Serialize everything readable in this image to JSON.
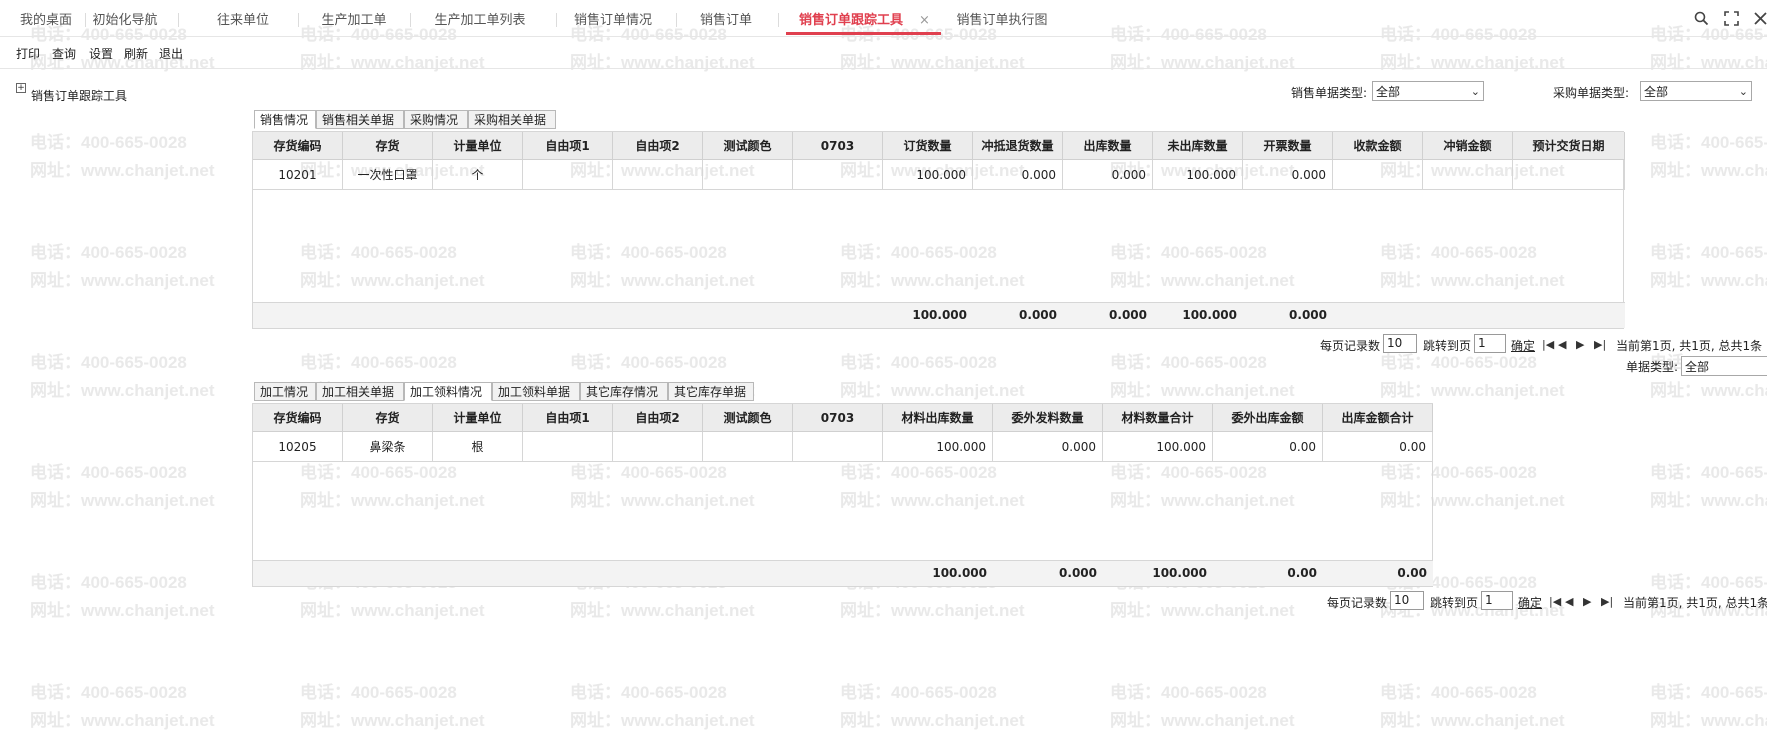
{
  "watermark": {
    "phone": "电话：400-665-0028",
    "site": "网址：www.chanjet.net"
  },
  "tabs": [
    {
      "label": "我的桌面"
    },
    {
      "label": "初始化导航"
    },
    {
      "label": "往来单位"
    },
    {
      "label": "生产加工单"
    },
    {
      "label": "生产加工单列表"
    },
    {
      "label": "销售订单情况"
    },
    {
      "label": "销售订单"
    },
    {
      "label": "销售订单跟踪工具",
      "active": true,
      "close": "×"
    },
    {
      "label": "销售订单执行图"
    }
  ],
  "top_icons": [
    "search-icon",
    "maximize-icon",
    "close-icon"
  ],
  "toolbar": {
    "print": "打印",
    "query": "查询",
    "settings": "设置",
    "refresh": "刷新",
    "exit": "退出"
  },
  "tree": {
    "expander": "+",
    "root_label": "销售订单跟踪工具"
  },
  "filters": {
    "sales_type_label": "销售单据类型:",
    "sales_type_value": "全部",
    "purchase_type_label": "采购单据类型:",
    "purchase_type_value": "全部",
    "doc_type_label": "单据类型:",
    "doc_type_value": "全部"
  },
  "upper": {
    "tabs": [
      "销售情况",
      "销售相关单据",
      "采购情况",
      "采购相关单据"
    ],
    "columns": [
      "存货编码",
      "存货",
      "计量单位",
      "自由项1",
      "自由项2",
      "测试颜色",
      "0703",
      "订货数量",
      "冲抵退货数量",
      "出库数量",
      "未出库数量",
      "开票数量",
      "收款金额",
      "冲销金额",
      "预计交货日期"
    ],
    "rows": [
      [
        "10201",
        "一次性口罩",
        "个",
        "",
        "",
        "",
        "",
        "100.000",
        "0.000",
        "0.000",
        "100.000",
        "0.000",
        "",
        "",
        ""
      ]
    ],
    "totals": [
      "",
      "",
      "",
      "",
      "",
      "",
      "",
      "100.000",
      "0.000",
      "0.000",
      "100.000",
      "0.000",
      "",
      "",
      ""
    ]
  },
  "lower": {
    "tabs": [
      "加工情况",
      "加工相关单据",
      "加工领料情况",
      "加工领料单据",
      "其它库存情况",
      "其它库存单据"
    ],
    "columns": [
      "存货编码",
      "存货",
      "计量单位",
      "自由项1",
      "自由项2",
      "测试颜色",
      "0703",
      "材料出库数量",
      "委外发料数量",
      "材料数量合计",
      "委外出库金额",
      "出库金额合计"
    ],
    "rows": [
      [
        "10205",
        "鼻梁条",
        "根",
        "",
        "",
        "",
        "",
        "100.000",
        "0.000",
        "100.000",
        "0.00",
        "0.00"
      ]
    ],
    "totals": [
      "",
      "",
      "",
      "",
      "",
      "",
      "",
      "100.000",
      "0.000",
      "100.000",
      "0.00",
      "0.00"
    ]
  },
  "pager_upper": {
    "per_page_label": "每页记录数",
    "per_page": "10",
    "jump_label": "跳转到页",
    "jump_page": "1",
    "confirm": "确定",
    "nav": [
      "|◀",
      "◀",
      "▶",
      "▶|"
    ],
    "status": "当前第1页, 共1页, 总共1条"
  },
  "pager_lower": {
    "per_page_label": "每页记录数",
    "per_page": "10",
    "jump_label": "跳转到页",
    "jump_page": "1",
    "confirm": "确定",
    "nav": [
      "|◀",
      "◀",
      "▶",
      "▶|"
    ],
    "status": "当前第1页, 共1页, 总共1条"
  },
  "colors": {
    "accent": "#e0404f",
    "header_bg": "#ececec",
    "border": "#d6d6d6"
  }
}
